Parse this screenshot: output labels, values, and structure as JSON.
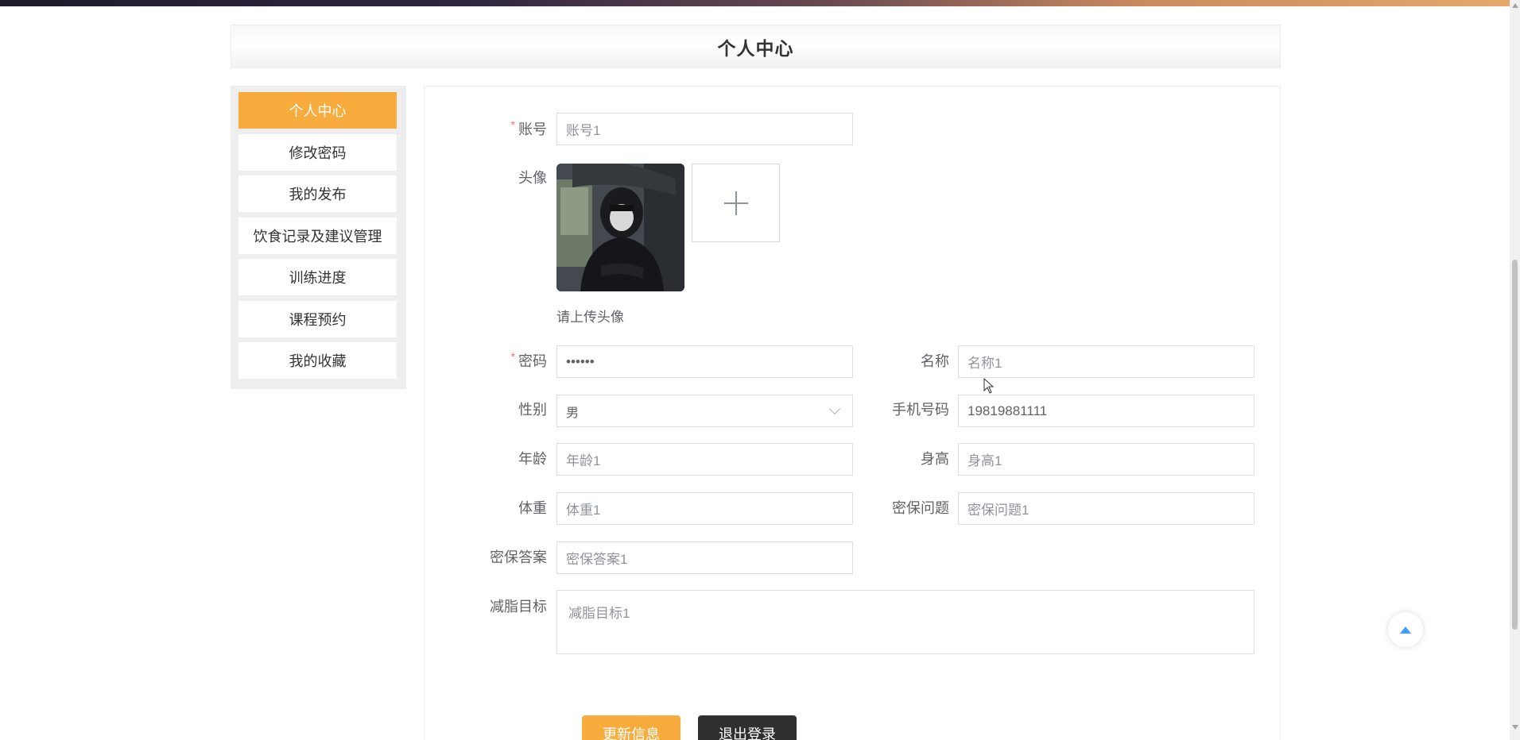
{
  "header": {
    "title": "个人中心"
  },
  "sidebar": {
    "items": [
      {
        "label": "个人中心",
        "active": true
      },
      {
        "label": "修改密码"
      },
      {
        "label": "我的发布"
      },
      {
        "label": "饮食记录及建议管理"
      },
      {
        "label": "训练进度"
      },
      {
        "label": "课程预约"
      },
      {
        "label": "我的收藏"
      }
    ]
  },
  "form": {
    "account": {
      "label": "账号",
      "required": "*",
      "value": "账号1"
    },
    "avatar": {
      "label": "头像",
      "hint": "请上传头像",
      "upload_icon": "plus-icon"
    },
    "password": {
      "label": "密码",
      "required": "*",
      "value": "••••••"
    },
    "name": {
      "label": "名称",
      "value": "名称1"
    },
    "gender": {
      "label": "性别",
      "value": "男"
    },
    "phone": {
      "label": "手机号码",
      "value": "19819881111"
    },
    "age": {
      "label": "年龄",
      "value": "年龄1"
    },
    "height": {
      "label": "身高",
      "value": "身高1"
    },
    "weight": {
      "label": "体重",
      "value": "体重1"
    },
    "security_question": {
      "label": "密保问题",
      "value": "密保问题1"
    },
    "security_answer": {
      "label": "密保答案",
      "value": "密保答案1"
    },
    "fat_loss_goal": {
      "label": "减脂目标",
      "value": "减脂目标1"
    }
  },
  "buttons": {
    "update": "更新信息",
    "logout": "退出登录"
  },
  "colors": {
    "accent": "#f7ac3d",
    "dark_button": "#2f2f2f",
    "required": "#f56c6c",
    "back_top_arrow": "#409eff"
  }
}
